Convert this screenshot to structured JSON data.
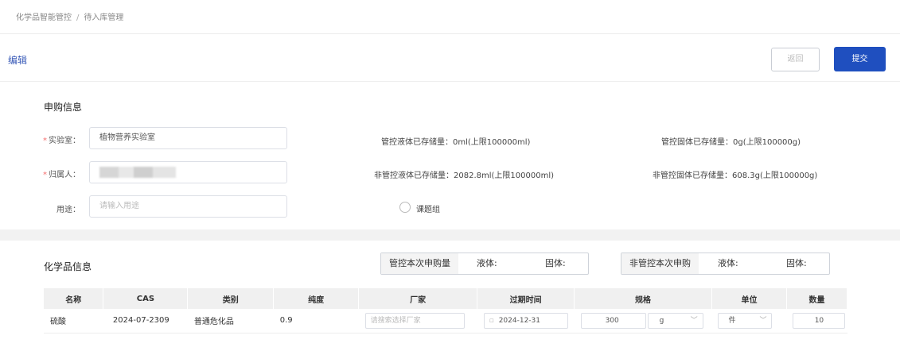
{
  "breadcrumb": {
    "root": "化学品智能管控",
    "separator": "/",
    "current": "待入库管理"
  },
  "header": {
    "title": "编辑",
    "back_label": "返回",
    "submit_label": "提交"
  },
  "purchase": {
    "section_title": "申购信息",
    "lab_label": "实验室：",
    "lab_value": "植物营养实验室",
    "owner_label": "归属人：",
    "purpose_label": "用途：",
    "purpose_placeholder": "请输入用途",
    "ctrl_liquid": "管控液体已存储量：0ml(上限100000ml)",
    "ctrl_solid": "管控固体已存储量：0g(上限100000g)",
    "nonctrl_liquid": "非管控液体已存储量：2082.8ml(上限100000ml)",
    "nonctrl_solid": "非管控固体已存储量：608.3g(上限100000g)",
    "group_label": "课题组"
  },
  "chemicals": {
    "section_title": "化学品信息",
    "ctrl_box": {
      "tag": "管控本次申购量",
      "liquid": "液体:",
      "solid": "固体:"
    },
    "nonctrl_box": {
      "tag": "非管控本次申购",
      "liquid": "液体:",
      "solid": "固体:"
    },
    "columns": [
      "名称",
      "CAS",
      "类别",
      "纯度",
      "厂家",
      "过期时间",
      "规格",
      "单位",
      "数量"
    ],
    "row": {
      "name": "硫酸",
      "cas": "2024-07-2309",
      "category": "普通危化品",
      "purity": "0.9",
      "maker_placeholder": "请搜索选择厂家",
      "expiry": "2024-12-31",
      "spec_value": "300",
      "spec_unit": "g",
      "unit": "件",
      "quantity": "10"
    }
  },
  "colors": {
    "primary": "#1f4fbf",
    "title": "#3a5bb8",
    "required": "#f56c6c"
  }
}
